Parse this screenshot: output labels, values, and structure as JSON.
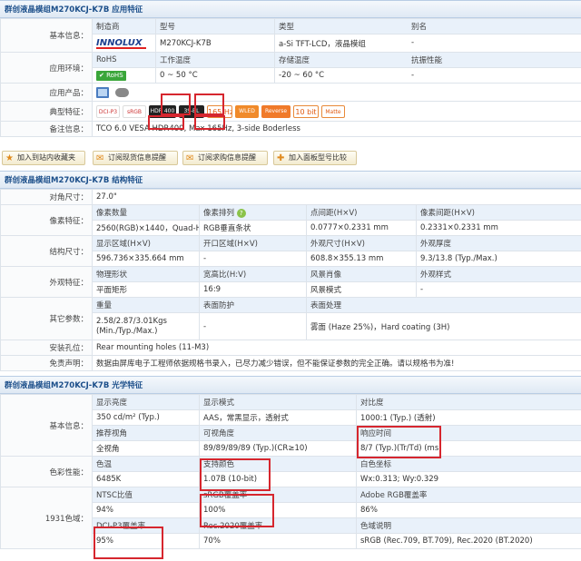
{
  "s1": {
    "title": "群创液晶模组M270KCJ-K7B 应用特征",
    "basic_label": "基本信息：",
    "h_maker": "制造商",
    "h_model": "型号",
    "h_type": "类型",
    "h_alias": "别名",
    "logo": "INNOLUX",
    "model": "M270KCJ-K7B",
    "type": "a-Si TFT-LCD，液晶模组",
    "alias": "-",
    "env_label": "应用环境：",
    "h_rohs": "RoHS",
    "h_temp": "工作温度",
    "h_store": "存储温度",
    "h_vib": "抗振性能",
    "rohs": "RoHS",
    "temp": "0 ~ 50 °C",
    "store": "-20 ~ 60 °C",
    "vib": "-",
    "product_label": "应用产品：",
    "typical_label": "典型特征：",
    "icons": [
      "DCI-P3",
      "sRGB",
      "HDR 400",
      "3S-BL",
      "165 Hz",
      "WLED",
      "Reverse",
      "10 bit",
      "Matte"
    ],
    "note_label": "备注信息：",
    "note_a": "TCO 6.0 VESA ",
    "note_b": "HDR400",
    "note_c": ", Max ",
    "note_d": "165Hz",
    "note_e": ", 3-side Boderless"
  },
  "buttons": [
    "加入到站内收藏夹",
    "订阅现货信息提醒",
    "订阅求购信息提醒",
    "加入面板型号比较"
  ],
  "s2": {
    "title": "群创液晶模组M270KCJ-K7B 结构特征",
    "diag_label": "对角尺寸：",
    "diag": "27.0\"",
    "pix_label": "像素特征：",
    "h_pixnum": "像素数量",
    "h_pixarr": "像素排列",
    "h_dot": "点间距(H×V)",
    "h_pitch": "像素间距(H×V)",
    "pixnum": "2560(RGB)×1440，Quad-HD",
    "pixarr": "RGB垂直条状",
    "dot": "0.0777×0.2331 mm",
    "pitch": "0.2331×0.2331 mm",
    "struct_label": "结构尺寸：",
    "h_area": "显示区域(H×V)",
    "h_open": "开口区域(H×V)",
    "h_outline": "外观尺寸(H×V)",
    "h_thick": "外观厚度",
    "area": "596.736×335.664 mm",
    "open": "-",
    "outline": "608.8×355.13 mm",
    "thick": "9.3/13.8 (Typ./Max.)",
    "look_label": "外观特征：",
    "h_shape": "物理形状",
    "h_ratio": "宽高比(H:V)",
    "h_style": "风景肖像",
    "h_pstyle": "外观样式",
    "shape": "平面矩形",
    "ratio": "16:9",
    "style": "风景模式",
    "pstyle": "-",
    "other_label": "其它参数：",
    "h_weight": "重量",
    "h_surf": "表面防护",
    "h_treat": "表面处理",
    "weight": "2.58/2.87/3.01Kgs (Min./Typ./Max.)",
    "surf": "-",
    "treat": "雾面 (Haze 25%)，Hard coating (3H)",
    "mount_label": "安装孔位：",
    "mount": "Rear mounting holes (11-M3)",
    "disclaimer_label": "免责声明：",
    "disclaimer": "数据由屏库电子工程师依据规格书录入，已尽力减少错误，但不能保证参数的完全正确。请以规格书为准!"
  },
  "s3": {
    "title": "群创液晶模组M270KCJ-K7B 光学特征",
    "basic_label": "基本信息：",
    "h_bright": "显示亮度",
    "h_mode": "显示模式",
    "h_contrast": "对比度",
    "bright": "350 cd/m² (Typ.)",
    "mode": "AAS，常黑显示，透射式",
    "contrast": "1000:1 (Typ.) (透射)",
    "h_angle": "推荐视角",
    "h_view": "可视角度",
    "h_resp": "响应时间",
    "angle": "全视角",
    "view": "89/89/89/89 (Typ.)(CR≥10)",
    "resp": "8/7 (Typ.)(Tr/Td) (ms)",
    "color_label": "色彩性能：",
    "h_ctemp": "色温",
    "h_colors": "支持颜色",
    "h_white": "白色坐标",
    "ctemp": "6485K",
    "colors": "1.07B (10-bit)",
    "white": "Wx:0.313; Wy:0.329",
    "gamut_label": "1931色域：",
    "h_ntsc": "NTSC比值",
    "h_srgb": "sRGB覆盖率",
    "h_adobe": "Adobe RGB覆盖率",
    "ntsc": "94%",
    "srgb": "100%",
    "adobe": "86%",
    "h_dci": "DCI-P3覆盖率",
    "h_rec": "Rec.2020覆盖率",
    "h_gdesc": "色域说明",
    "dci": "95%",
    "rec": "70%",
    "gdesc": "sRGB (Rec.709, BT.709), Rec.2020 (BT.2020)"
  },
  "colors": {
    "title": "#1c4f8a",
    "header_bg": "#e9f1fa",
    "highlight": "#d6262e"
  }
}
